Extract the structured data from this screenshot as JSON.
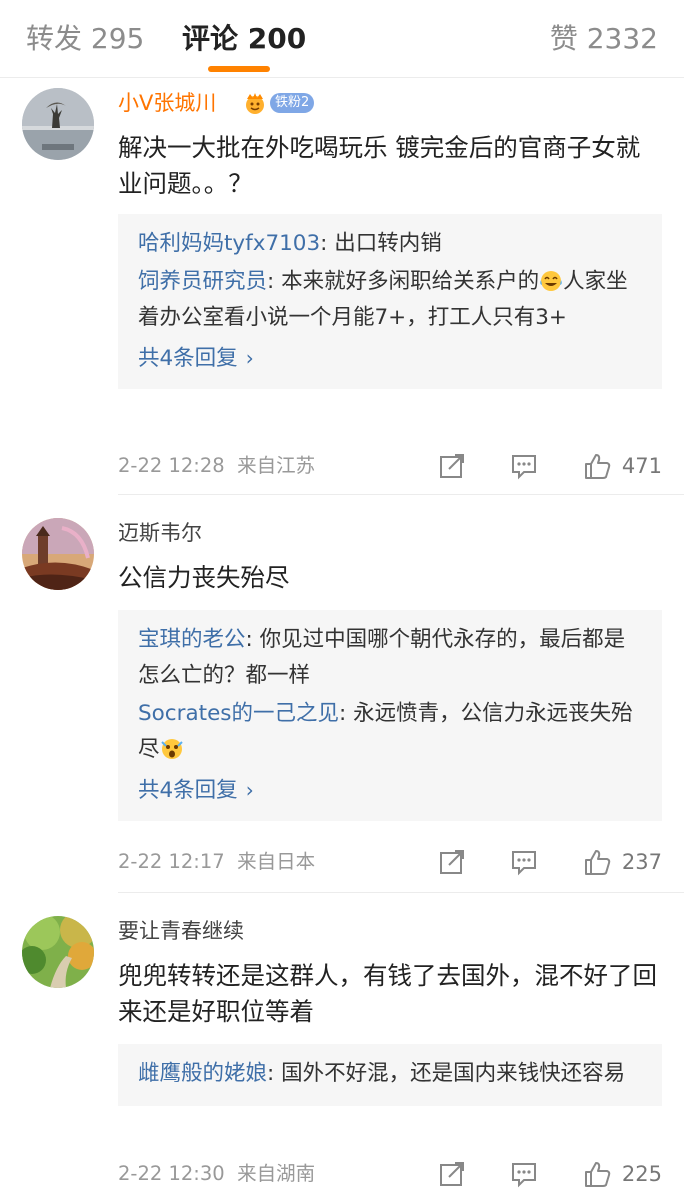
{
  "tabs": {
    "repost_label": "转发 295",
    "comments_label": "评论 200",
    "likes_label": "赞 2332"
  },
  "colors": {
    "accent": "#ff8200",
    "link": "#3f6fa8",
    "vip_name": "#ff7400",
    "reply_bg": "#f6f6f6"
  },
  "comments": [
    {
      "username": "小V张城川",
      "fan_badge": "铁粉2",
      "text": "解决一大批在外吃喝玩乐 镀完金后的官商子女就业问题。。？",
      "replies": [
        {
          "user": "哈利妈妈tyfx7103",
          "sep": ": ",
          "text": "出口转内销"
        },
        {
          "user": "饲养员研究员",
          "sep": ": ",
          "text": "本来就好多闲职给关系户的",
          "emoji": "laugh-cry-emoji",
          "text2": "人家坐着办公室看小说一个月能7+，打工人只有3+"
        }
      ],
      "more_replies": "共4条回复",
      "time": "2-22 12:28",
      "location": "来自江苏",
      "likes": "471"
    },
    {
      "username": "迈斯韦尔",
      "text": "公信力丧失殆尽",
      "replies": [
        {
          "user": "宝琪的老公",
          "sep": ": ",
          "text": "你见过中国哪个朝代永存的，最后都是怎么亡的？都一样"
        },
        {
          "user": "Socrates的一己之见",
          "sep": ": ",
          "text": "永远愤青，公信力永远丧失殆尽",
          "emoji": "shocked-emoji"
        }
      ],
      "more_replies": "共4条回复",
      "time": "2-22 12:17",
      "location": "来自日本",
      "likes": "237"
    },
    {
      "username": "要让青春继续",
      "text": "兜兜转转还是这群人，有钱了去国外，混不好了回来还是好职位等着",
      "replies": [
        {
          "user": "雌鹰般的姥娘",
          "sep": ": ",
          "text": "国外不好混，还是国内来钱快还容易"
        }
      ],
      "time": "2-22 12:30",
      "location": "来自湖南",
      "likes": "225"
    }
  ]
}
